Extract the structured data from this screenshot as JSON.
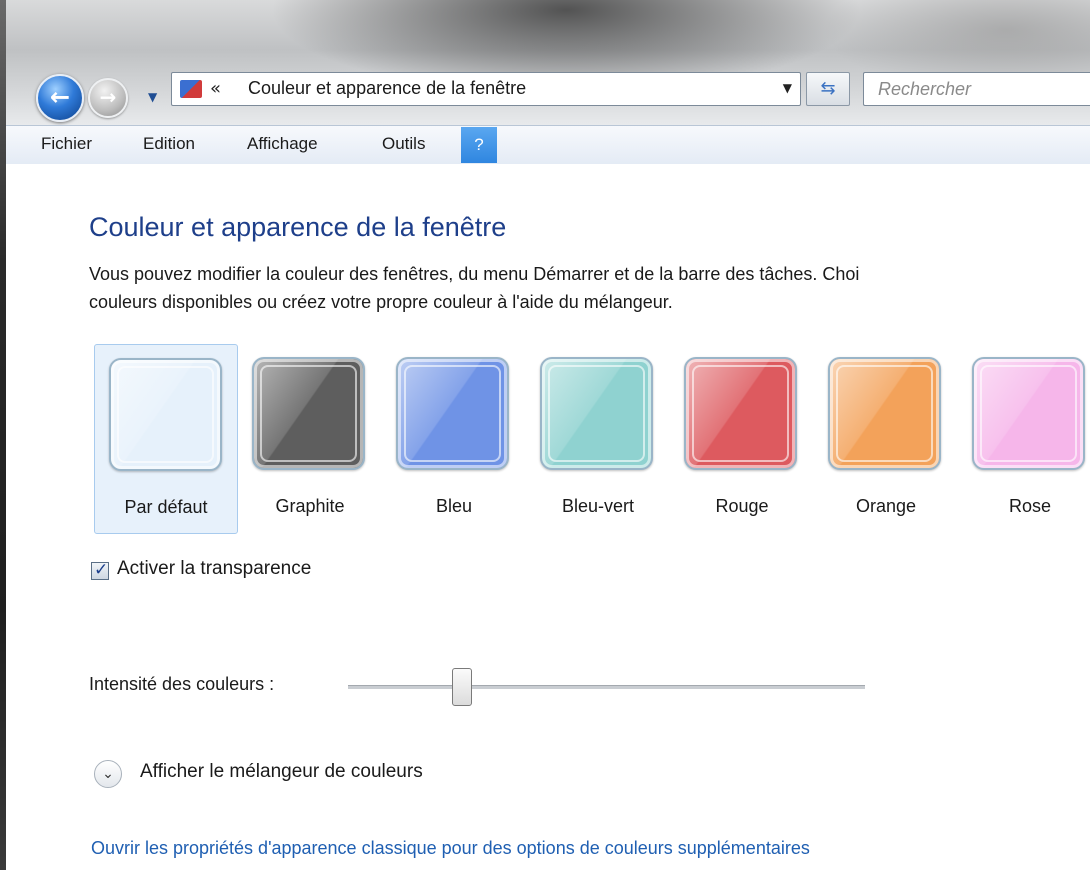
{
  "nav": {
    "address_path": "Couleur et apparence de la fenêtre",
    "breadcrumb_chevron": "«",
    "search_placeholder": "Rechercher"
  },
  "menu": {
    "items": [
      "Fichier",
      "Edition",
      "Affichage",
      "Outils"
    ],
    "help": "?"
  },
  "main": {
    "title": "Couleur et apparence de la fenêtre",
    "description_line1": "Vous pouvez modifier la couleur des fenêtres, du menu Démarrer et de la barre des tâches. Choi",
    "description_line2": "couleurs disponibles ou créez votre propre couleur à l'aide du mélangeur.",
    "swatches": [
      {
        "label": "Par défaut",
        "color": "#e6f1fb",
        "selected": true
      },
      {
        "label": "Graphite",
        "color": "#5e5e5e",
        "selected": false
      },
      {
        "label": "Bleu",
        "color": "#6f93e6",
        "selected": false
      },
      {
        "label": "Bleu-vert",
        "color": "#8fd2d0",
        "selected": false
      },
      {
        "label": "Rouge",
        "color": "#dd5a5f",
        "selected": false
      },
      {
        "label": "Orange",
        "color": "#f3a25a",
        "selected": false
      },
      {
        "label": "Rose",
        "color": "#f6b6ea",
        "selected": false
      }
    ],
    "transparency_label": "Activer la transparence",
    "transparency_checked": true,
    "intensity_label": "Intensité des couleurs :",
    "intensity_value": 0.22,
    "mixer_label": "Afficher le mélangeur de couleurs",
    "classic_link": "Ouvrir les propriétés d'apparence classique pour des options de couleurs supplémentaires"
  },
  "colors": {
    "title_blue": "#1e3f8a",
    "link_blue": "#1f5fb2",
    "menu_help_bg": "#2f86e0"
  }
}
